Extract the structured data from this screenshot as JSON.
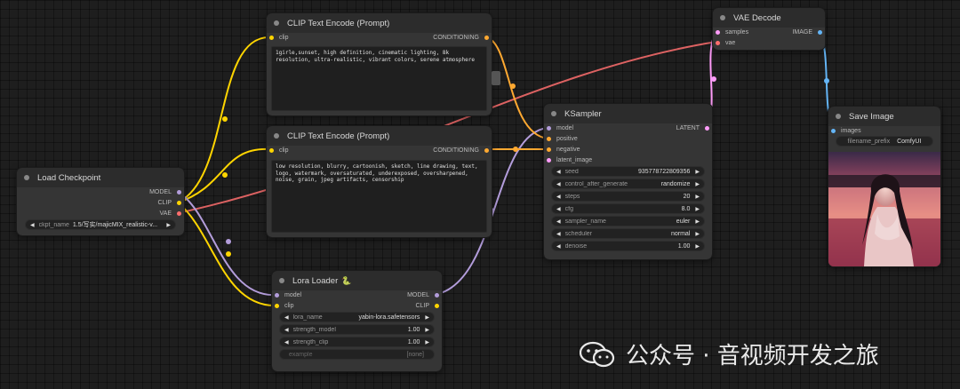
{
  "nodes": {
    "clip_pos": {
      "title": "CLIP Text Encode (Prompt)",
      "input": "clip",
      "output": "CONDITIONING",
      "text": "1girle,sunset, high definition, cinematic lighting, 8k resolution, ultra-realistic, vibrant colors, serene atmosphere"
    },
    "clip_neg": {
      "title": "CLIP Text Encode (Prompt)",
      "input": "clip",
      "output": "CONDITIONING",
      "text": "low resolution, blurry, cartoonish, sketch, line drawing, text, logo, watermark, oversaturated, underexposed, oversharpened, noise, grain, jpeg artifacts, censorship"
    },
    "vae_decode": {
      "title": "VAE Decode",
      "inputs": [
        "samples",
        "vae"
      ],
      "output": "IMAGE"
    },
    "load_checkpoint": {
      "title": "Load Checkpoint",
      "outputs": [
        "MODEL",
        "CLIP",
        "VAE"
      ],
      "ckpt_label": "ckpt_name",
      "ckpt_value": "1.5/写实/majicMIX_realistic-v..."
    },
    "ksampler": {
      "title": "KSampler",
      "inputs": [
        "model",
        "positive",
        "negative",
        "latent_image"
      ],
      "output": "LATENT",
      "widgets": [
        {
          "label": "seed",
          "value": "935778722809356"
        },
        {
          "label": "control_after_generate",
          "value": "randomize"
        },
        {
          "label": "steps",
          "value": "20"
        },
        {
          "label": "cfg",
          "value": "8.0"
        },
        {
          "label": "sampler_name",
          "value": "euler"
        },
        {
          "label": "scheduler",
          "value": "normal"
        },
        {
          "label": "denoise",
          "value": "1.00"
        }
      ]
    },
    "save_image": {
      "title": "Save Image",
      "input": "images",
      "widget": {
        "label": "filename_prefix",
        "value": "ComfyUI"
      }
    },
    "lora_loader": {
      "title": "Lora Loader",
      "inputs": [
        "model",
        "clip"
      ],
      "outputs": [
        "MODEL",
        "CLIP"
      ],
      "widgets": [
        {
          "label": "lora_name",
          "value": "yabin-lora.safetensors"
        },
        {
          "label": "strength_model",
          "value": "1.00"
        },
        {
          "label": "strength_clip",
          "value": "1.00"
        }
      ],
      "example": {
        "label": "example",
        "value": "[none]"
      }
    }
  },
  "watermark": {
    "text": "公众号 · 音视频开发之旅"
  },
  "colors": {
    "clip": "#ffd500",
    "model": "#b39ddb",
    "vae": "#ff6e6e",
    "conditioning": "#ffa931",
    "latent": "#ff9cf9",
    "image": "#64b5f6"
  }
}
